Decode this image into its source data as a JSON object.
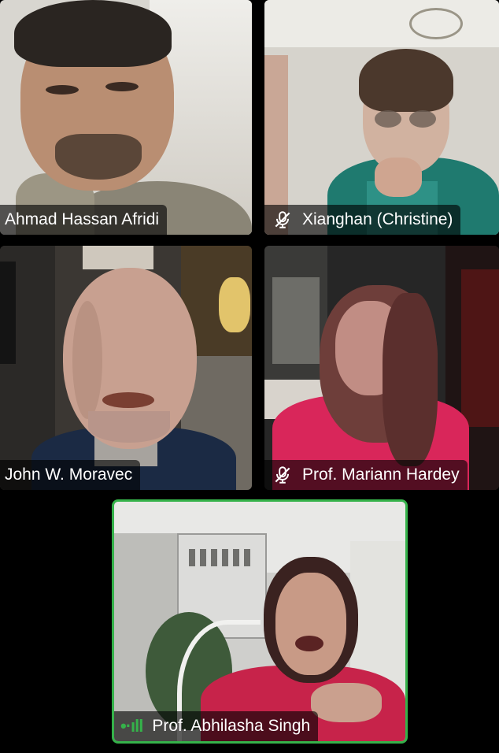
{
  "participants": [
    {
      "id": "tile-1",
      "name": "Ahmad Hassan Afridi",
      "muted": false
    },
    {
      "id": "tile-2",
      "name": "Xianghan (Christine)",
      "muted": true
    },
    {
      "id": "tile-3",
      "name": "John W. Moravec",
      "muted": false
    },
    {
      "id": "tile-4",
      "name": "Prof. Mariann Hardey",
      "muted": true
    },
    {
      "id": "tile-5",
      "name": "Prof. Abhilasha Singh",
      "muted": false,
      "speaking": true
    }
  ],
  "icons": {
    "muted": "mic-off-icon",
    "speaking": "audio-level-icon"
  },
  "colors": {
    "active_speaker": "#35b24a",
    "label_bg": "rgba(0,0,0,0.62)"
  }
}
